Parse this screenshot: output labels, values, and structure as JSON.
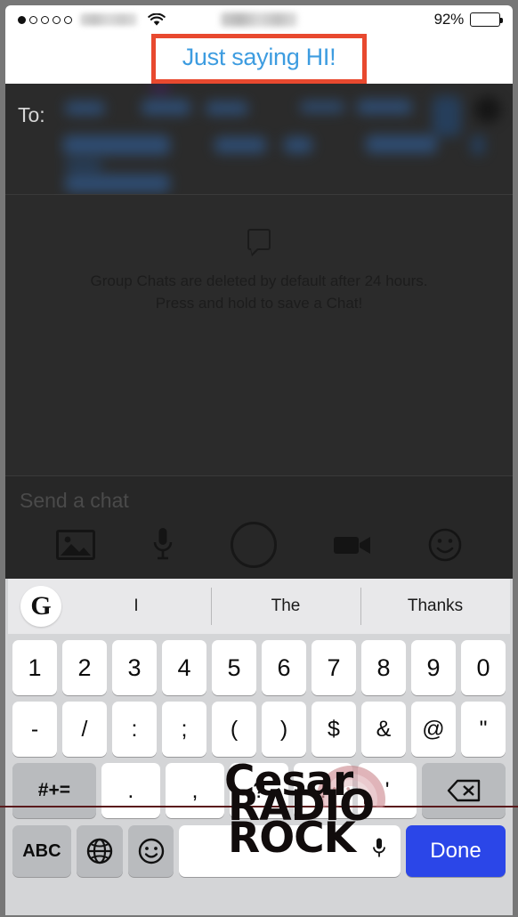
{
  "status_bar": {
    "signal_dots_total": 5,
    "signal_dots_filled": 1,
    "carrier": "",
    "time": "",
    "wifi_icon": "wifi-icon",
    "battery_percent": "92%",
    "battery_level": 100
  },
  "annotation": {
    "text": "Just saying HI!",
    "box_color": "#e8492f",
    "text_color": "#3d9ce0"
  },
  "chat": {
    "to_label": "To:",
    "recipients": "",
    "empty_icon": "chat-bubble-icon",
    "empty_line_1": "Group Chats are deleted by default after 24 hours.",
    "empty_line_2": "Press and hold to save a Chat!",
    "input_placeholder": "Send a chat",
    "actions": [
      {
        "name": "gallery-icon",
        "label": "Gallery"
      },
      {
        "name": "microphone-icon",
        "label": "Audio note"
      },
      {
        "name": "camera-capture-icon",
        "label": "Camera"
      },
      {
        "name": "video-camera-icon",
        "label": "Video note"
      },
      {
        "name": "sticker-smiley-icon",
        "label": "Stickers"
      }
    ]
  },
  "keyboard": {
    "brand_icon": "google-g-icon",
    "brand_letter": "G",
    "suggestions": [
      "I",
      "The",
      "Thanks"
    ],
    "row_numbers": [
      "1",
      "2",
      "3",
      "4",
      "5",
      "6",
      "7",
      "8",
      "9",
      "0"
    ],
    "row_symbols": [
      "-",
      "/",
      ":",
      ";",
      "(",
      ")",
      "$",
      "&",
      "@",
      "\""
    ],
    "row_punct": {
      "shift_label": "#+=",
      "keys": [
        ".",
        ",",
        "?",
        "!",
        "'"
      ],
      "backspace_icon": "backspace-icon"
    },
    "row_bottom": {
      "abc_label": "ABC",
      "globe_icon": "globe-icon",
      "emoji_icon": "emoji-icon",
      "space_label": "",
      "space_mic_icon": "microphone-icon",
      "done_label": "Done",
      "done_color": "#2b46e8"
    }
  },
  "watermark": {
    "line_1": "Cesar",
    "line_2": "RADIO",
    "line_3": "ROCK",
    "full_text": "Cesar RADIO ROCK"
  }
}
